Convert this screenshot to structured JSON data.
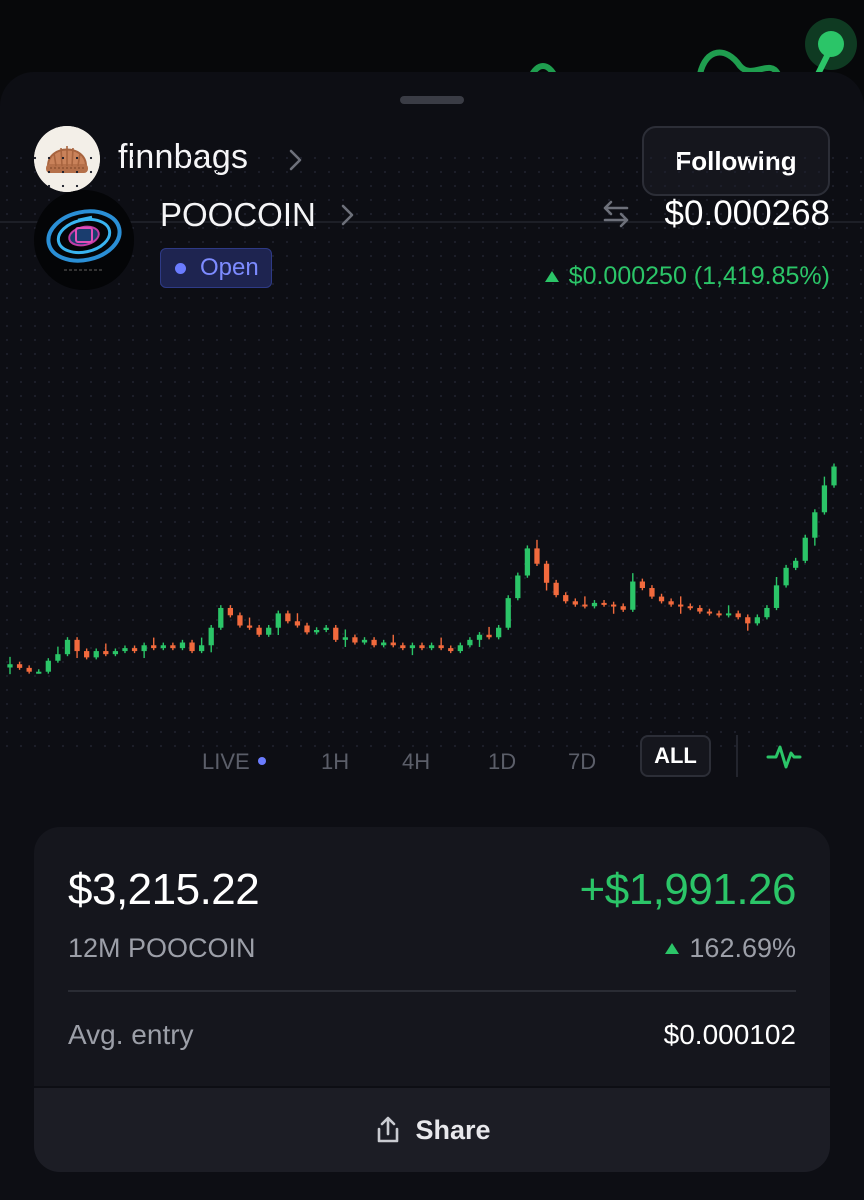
{
  "user": {
    "username": "finnbags",
    "follow_label": "Following"
  },
  "coin": {
    "name": "POOCOIN",
    "status": "Open",
    "price": "$0.000268",
    "change": "$0.000250 (1,419.85%)"
  },
  "timeframes": {
    "items": [
      "LIVE",
      "1H",
      "4H",
      "1D",
      "7D",
      "ALL"
    ],
    "selected": "ALL"
  },
  "position": {
    "value": "$3,215.22",
    "pnl": "+$1,991.26",
    "amount": "12M POOCOIN",
    "pnl_percent": "162.69%",
    "entry_label": "Avg. entry",
    "entry_value": "$0.000102",
    "share_label": "Share"
  },
  "colors": {
    "up": "#2bc568",
    "down": "#f26a3d",
    "accent": "#6b7cff",
    "background": "#0d0e14"
  },
  "chart_data": {
    "type": "candlestick",
    "description_series": "price",
    "timeframe": "ALL",
    "values": [
      1.8e-05,
      1.7e-05,
      1.6e-05,
      1.6e-05,
      1.9e-05,
      2.1e-05,
      2.6e-05,
      2.2e-05,
      2e-05,
      2.2e-05,
      2.1e-05,
      2.2e-05,
      2.3e-05,
      2.2e-05,
      2.4e-05,
      2.3e-05,
      2.4e-05,
      2.3e-05,
      2.5e-05,
      2.2e-05,
      2.4e-05,
      3.1e-05,
      4.1e-05,
      3.7e-05,
      3.2e-05,
      3.1e-05,
      2.8e-05,
      3.1e-05,
      3.8e-05,
      3.4e-05,
      3.2e-05,
      2.9e-05,
      3e-05,
      3.1e-05,
      2.6e-05,
      2.7e-05,
      2.5e-05,
      2.6e-05,
      2.4e-05,
      2.5e-05,
      2.4e-05,
      2.3e-05,
      2.4e-05,
      2.3e-05,
      2.4e-05,
      2.3e-05,
      2.2e-05,
      2.4e-05,
      2.6e-05,
      2.8e-05,
      2.7e-05,
      3.1e-05,
      4.7e-05,
      6.4e-05,
      9.2e-05,
      7.5e-05,
      5.8e-05,
      4.9e-05,
      4.5e-05,
      4.3e-05,
      4.2e-05,
      4.4e-05,
      4.3e-05,
      4.2e-05,
      4e-05,
      5.9e-05,
      5.4e-05,
      4.8e-05,
      4.5e-05,
      4.3e-05,
      4.2e-05,
      4.1e-05,
      3.9e-05,
      3.8e-05,
      3.7e-05,
      3.8e-05,
      3.6e-05,
      3.3e-05,
      3.6e-05,
      4.1e-05,
      5.6e-05,
      7.1e-05,
      7.8e-05,
      0.000106,
      0.000148,
      0.00021,
      0.000268
    ]
  }
}
